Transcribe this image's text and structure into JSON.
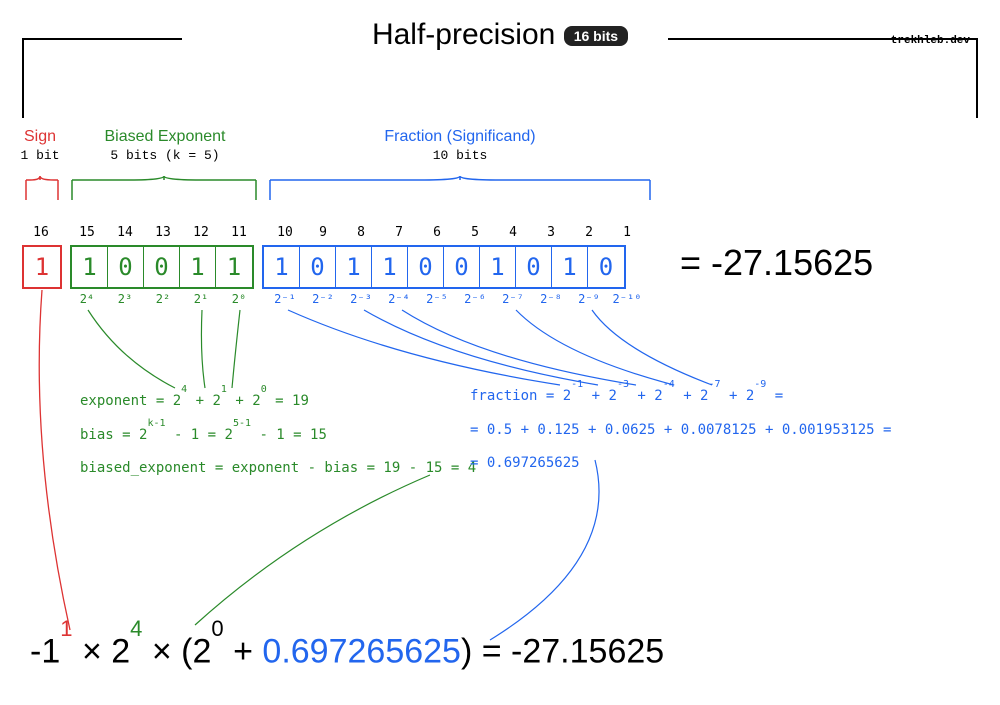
{
  "title": "Half-precision",
  "badge": "16 bits",
  "attribution": "trekhleb.dev",
  "sections": {
    "sign": {
      "label": "Sign",
      "sub": "1 bit"
    },
    "exponent": {
      "label": "Biased Exponent",
      "sub": "5 bits (k = 5)"
    },
    "fraction": {
      "label": "Fraction (Significand)",
      "sub": "10 bits"
    }
  },
  "bit_indices": [
    "16",
    "15",
    "14",
    "13",
    "12",
    "11",
    "10",
    "9",
    "8",
    "7",
    "6",
    "5",
    "4",
    "3",
    "2",
    "1"
  ],
  "bits": {
    "sign": [
      "1"
    ],
    "exponent": [
      "1",
      "0",
      "0",
      "1",
      "1"
    ],
    "fraction": [
      "1",
      "0",
      "1",
      "1",
      "0",
      "0",
      "1",
      "0",
      "1",
      "0"
    ]
  },
  "powers": {
    "exponent": [
      "2⁴",
      "2³",
      "2²",
      "2¹",
      "2⁰"
    ],
    "fraction": [
      "2⁻¹",
      "2⁻²",
      "2⁻³",
      "2⁻⁴",
      "2⁻⁵",
      "2⁻⁶",
      "2⁻⁷",
      "2⁻⁸",
      "2⁻⁹",
      "2⁻¹⁰"
    ]
  },
  "result_eq": "=  -27.15625",
  "exponent_calc": {
    "line1_pre": "exponent = 2",
    "line1_s1": "4",
    "line1_mid1": "+ 2",
    "line1_s2": "1",
    "line1_mid2": "+ 2",
    "line1_s3": "0",
    "line1_post": "= 19",
    "line2_pre": "bias = 2",
    "line2_s1": "k-1",
    "line2_mid": "- 1 = 2",
    "line2_s2": "5-1",
    "line2_post": "- 1 = 15",
    "line3": "biased_exponent = exponent - bias = 19 - 15 = 4"
  },
  "fraction_calc": {
    "line1_pre": "fraction = 2",
    "line1_s1": "-1",
    "line1_m1": "+ 2",
    "line1_s2": "-3",
    "line1_m2": "+ 2",
    "line1_s3": "-4",
    "line1_m3": "+ 2",
    "line1_s4": "-7",
    "line1_m4": "+ 2",
    "line1_s5": "-9",
    "line1_post": "=",
    "line2": "= 0.5 + 0.125 + 0.0625 + 0.0078125 + 0.001953125 =",
    "line3": "= 0.697265625"
  },
  "final": {
    "neg1": "-1",
    "sup1": "1",
    "times1": " × 2",
    "sup2": "4",
    "times2": " × (2",
    "sup3": "0",
    "plus": "+ ",
    "frac": "0.697265625",
    "close": ") = -27.15625"
  }
}
